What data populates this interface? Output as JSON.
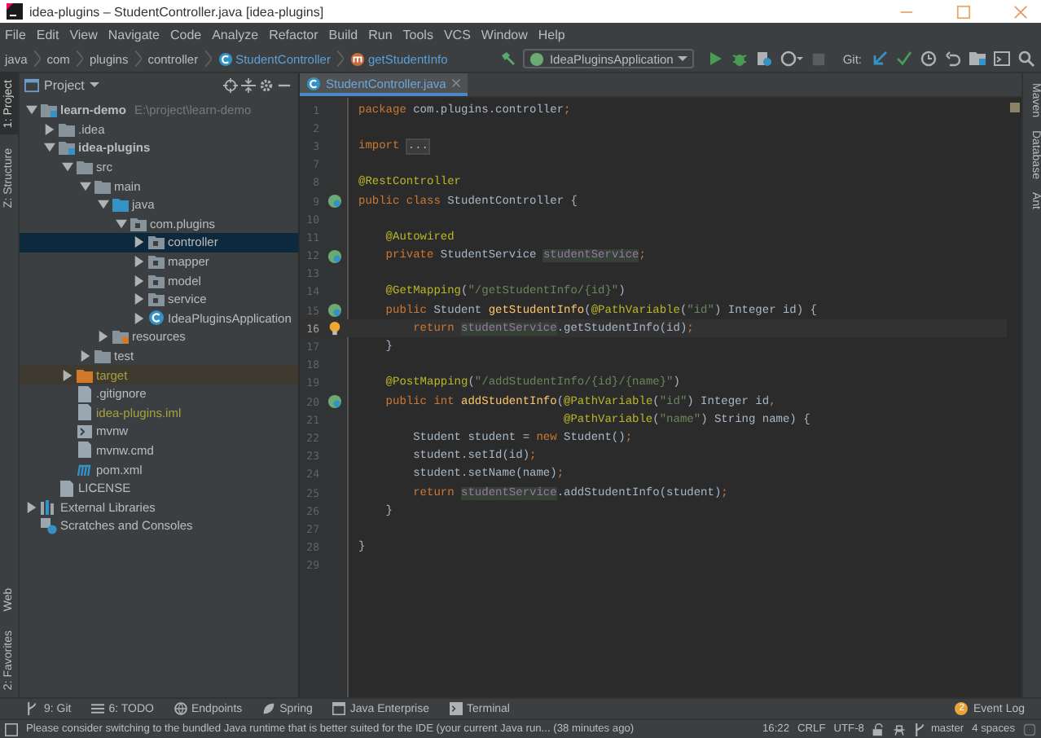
{
  "window": {
    "title": "idea-plugins – StudentController.java [idea-plugins]"
  },
  "menu": [
    "File",
    "Edit",
    "View",
    "Navigate",
    "Code",
    "Analyze",
    "Refactor",
    "Build",
    "Run",
    "Tools",
    "VCS",
    "Window",
    "Help"
  ],
  "breadcrumbs": [
    {
      "label": "java",
      "kind": "plain"
    },
    {
      "label": "com",
      "kind": "plain"
    },
    {
      "label": "plugins",
      "kind": "plain"
    },
    {
      "label": "controller",
      "kind": "plain"
    },
    {
      "label": "StudentController",
      "kind": "class"
    },
    {
      "label": "getStudentInfo",
      "kind": "method"
    }
  ],
  "run_config": "IdeaPluginsApplication",
  "git_label": "Git:",
  "left_stripe": [
    {
      "label": "1: Project",
      "selected": true
    },
    {
      "label": "Z: Structure",
      "selected": false
    }
  ],
  "left_stripe_bottom": [
    {
      "label": "Web",
      "selected": false
    },
    {
      "label": "2: Favorites",
      "selected": false
    }
  ],
  "right_stripe": [
    "Maven",
    "Database",
    "Ant"
  ],
  "project_panel": {
    "title": "Project",
    "tree": [
      {
        "label": "learn-demo",
        "kind": "module",
        "path": "E:\\project\\learn-demo",
        "expanded": true,
        "selected": false,
        "ignored": false,
        "children": [
          {
            "label": ".idea",
            "kind": "folder",
            "expanded": false,
            "selected": false,
            "ignored": false
          },
          {
            "label": "idea-plugins",
            "kind": "module",
            "expanded": true,
            "selected": false,
            "ignored": false,
            "children": [
              {
                "label": "src",
                "kind": "folder",
                "expanded": true,
                "selected": false,
                "ignored": false,
                "children": [
                  {
                    "label": "main",
                    "kind": "folder",
                    "expanded": true,
                    "selected": false,
                    "ignored": false,
                    "children": [
                      {
                        "label": "java",
                        "kind": "source",
                        "expanded": true,
                        "selected": false,
                        "ignored": false,
                        "children": [
                          {
                            "label": "com.plugins",
                            "kind": "package",
                            "expanded": true,
                            "selected": false,
                            "ignored": false,
                            "children": [
                              {
                                "label": "controller",
                                "kind": "package",
                                "expanded": false,
                                "selected": true,
                                "ignored": false
                              },
                              {
                                "label": "mapper",
                                "kind": "package",
                                "expanded": false,
                                "selected": false,
                                "ignored": false
                              },
                              {
                                "label": "model",
                                "kind": "package",
                                "expanded": false,
                                "selected": false,
                                "ignored": false
                              },
                              {
                                "label": "service",
                                "kind": "package",
                                "expanded": false,
                                "selected": false,
                                "ignored": false
                              },
                              {
                                "label": "IdeaPluginsApplication",
                                "kind": "spring-class",
                                "expanded": false,
                                "selected": false,
                                "ignored": false
                              }
                            ]
                          }
                        ]
                      },
                      {
                        "label": "resources",
                        "kind": "resources",
                        "expanded": false,
                        "selected": false,
                        "ignored": false
                      }
                    ]
                  },
                  {
                    "label": "test",
                    "kind": "folder",
                    "expanded": false,
                    "selected": false,
                    "ignored": false
                  }
                ]
              },
              {
                "label": "target",
                "kind": "excluded",
                "expanded": false,
                "selected": false,
                "ignored": true
              },
              {
                "label": ".gitignore",
                "kind": "file",
                "selected": false,
                "ignored": false
              },
              {
                "label": "idea-plugins.iml",
                "kind": "file",
                "selected": false,
                "ignored": true
              },
              {
                "label": "mvnw",
                "kind": "script",
                "selected": false,
                "ignored": false
              },
              {
                "label": "mvnw.cmd",
                "kind": "file",
                "selected": false,
                "ignored": false
              },
              {
                "label": "pom.xml",
                "kind": "maven",
                "selected": false,
                "ignored": false
              }
            ]
          },
          {
            "label": "LICENSE",
            "kind": "file",
            "selected": false,
            "ignored": false
          }
        ]
      },
      {
        "label": "External Libraries",
        "kind": "library",
        "expanded": false,
        "selected": false,
        "ignored": false
      },
      {
        "label": "Scratches and Consoles",
        "kind": "scratches",
        "selected": false,
        "ignored": false
      }
    ]
  },
  "editor": {
    "tabs": [
      {
        "label": "StudentController.java",
        "selected": true
      }
    ],
    "lines": [
      {
        "number": "1",
        "kind": "plain",
        "current": false,
        "tokens": [
          {
            "text": "package ",
            "kind": "kw"
          },
          {
            "text": "com.plugins.controller",
            "kind": "plain"
          },
          {
            "text": ";",
            "kind": "kw"
          }
        ]
      },
      {
        "number": "2",
        "kind": "plain",
        "current": false
      },
      {
        "number": "3",
        "kind": "plain",
        "current": false,
        "tokens": [
          {
            "text": "import ",
            "kind": "kw"
          },
          {
            "text": "...",
            "kind": "fold"
          }
        ]
      },
      {
        "number": "7",
        "kind": "plain",
        "current": false
      },
      {
        "number": "8",
        "kind": "plain",
        "current": false,
        "tokens": [
          {
            "text": "@RestController",
            "kind": "ann"
          }
        ]
      },
      {
        "number": "9",
        "kind": "bean",
        "current": false,
        "tokens": [
          {
            "text": "public class ",
            "kind": "kw"
          },
          {
            "text": "StudentController {",
            "kind": "plain"
          }
        ]
      },
      {
        "number": "10",
        "kind": "plain",
        "current": false
      },
      {
        "number": "11",
        "kind": "plain",
        "current": false,
        "tokens": [
          {
            "text": "    @Autowired",
            "kind": "ann"
          }
        ]
      },
      {
        "number": "12",
        "kind": "bean",
        "current": false,
        "tokens": [
          {
            "text": "    private ",
            "kind": "kw"
          },
          {
            "text": "StudentService ",
            "kind": "plain"
          },
          {
            "text": "studentService",
            "kind": "usage"
          },
          {
            "text": ";",
            "kind": "kw"
          }
        ]
      },
      {
        "number": "13",
        "kind": "plain",
        "current": false
      },
      {
        "number": "14",
        "kind": "plain",
        "current": false,
        "tokens": [
          {
            "text": "    @GetMapping",
            "kind": "ann"
          },
          {
            "text": "(",
            "kind": "plain"
          },
          {
            "text": "\"/getStudentInfo/{id}\"",
            "kind": "str"
          },
          {
            "text": ")",
            "kind": "plain"
          }
        ]
      },
      {
        "number": "15",
        "kind": "bean",
        "current": false,
        "tokens": [
          {
            "text": "    public ",
            "kind": "kw"
          },
          {
            "text": "Student ",
            "kind": "plain"
          },
          {
            "text": "getStudentInfo",
            "kind": "method"
          },
          {
            "text": "(",
            "kind": "plain"
          },
          {
            "text": "@PathVariable",
            "kind": "ann"
          },
          {
            "text": "(",
            "kind": "plain"
          },
          {
            "text": "\"id\"",
            "kind": "str"
          },
          {
            "text": ") Integer id) {",
            "kind": "plain"
          }
        ]
      },
      {
        "number": "16",
        "kind": "bulb",
        "current": true,
        "tokens": [
          {
            "text": "        return ",
            "kind": "kw"
          },
          {
            "text": "studentService",
            "kind": "usage"
          },
          {
            "text": ".getStudentInfo(id)",
            "kind": "plain"
          },
          {
            "text": ";",
            "kind": "kw"
          }
        ]
      },
      {
        "number": "17",
        "kind": "plain",
        "current": false,
        "tokens": [
          {
            "text": "    }",
            "kind": "plain"
          }
        ]
      },
      {
        "number": "18",
        "kind": "plain",
        "current": false
      },
      {
        "number": "19",
        "kind": "plain",
        "current": false,
        "tokens": [
          {
            "text": "    @PostMapping",
            "kind": "ann"
          },
          {
            "text": "(",
            "kind": "plain"
          },
          {
            "text": "\"/addStudentInfo/{id}/{name}\"",
            "kind": "str"
          },
          {
            "text": ")",
            "kind": "plain"
          }
        ]
      },
      {
        "number": "20",
        "kind": "bean",
        "current": false,
        "tokens": [
          {
            "text": "    public int ",
            "kind": "kw"
          },
          {
            "text": "addStudentInfo",
            "kind": "method"
          },
          {
            "text": "(",
            "kind": "plain"
          },
          {
            "text": "@PathVariable",
            "kind": "ann"
          },
          {
            "text": "(",
            "kind": "plain"
          },
          {
            "text": "\"id\"",
            "kind": "str"
          },
          {
            "text": ") Integer id",
            "kind": "plain"
          },
          {
            "text": ",",
            "kind": "kw"
          }
        ]
      },
      {
        "number": "21",
        "kind": "plain",
        "current": false,
        "tokens": [
          {
            "text": "                              @PathVariable",
            "kind": "ann"
          },
          {
            "text": "(",
            "kind": "plain"
          },
          {
            "text": "\"name\"",
            "kind": "str"
          },
          {
            "text": ") String name) {",
            "kind": "plain"
          }
        ]
      },
      {
        "number": "22",
        "kind": "plain",
        "current": false,
        "tokens": [
          {
            "text": "        Student student = ",
            "kind": "plain"
          },
          {
            "text": "new ",
            "kind": "kw"
          },
          {
            "text": "Student()",
            "kind": "plain"
          },
          {
            "text": ";",
            "kind": "kw"
          }
        ]
      },
      {
        "number": "23",
        "kind": "plain",
        "current": false,
        "tokens": [
          {
            "text": "        student.setId(id)",
            "kind": "plain"
          },
          {
            "text": ";",
            "kind": "kw"
          }
        ]
      },
      {
        "number": "24",
        "kind": "plain",
        "current": false,
        "tokens": [
          {
            "text": "        student.setName(name)",
            "kind": "plain"
          },
          {
            "text": ";",
            "kind": "kw"
          }
        ]
      },
      {
        "number": "25",
        "kind": "plain",
        "current": false,
        "tokens": [
          {
            "text": "        return ",
            "kind": "kw"
          },
          {
            "text": "studentService",
            "kind": "usage"
          },
          {
            "text": ".addStudentInfo(student)",
            "kind": "plain"
          },
          {
            "text": ";",
            "kind": "kw"
          }
        ]
      },
      {
        "number": "26",
        "kind": "plain",
        "current": false,
        "tokens": [
          {
            "text": "    }",
            "kind": "plain"
          }
        ]
      },
      {
        "number": "27",
        "kind": "plain",
        "current": false
      },
      {
        "number": "28",
        "kind": "plain",
        "current": false,
        "tokens": [
          {
            "text": "}",
            "kind": "plain"
          }
        ]
      },
      {
        "number": "29",
        "kind": "plain",
        "current": false
      }
    ]
  },
  "tool_windows": [
    {
      "label": "9: Git",
      "kind": "git"
    },
    {
      "label": "6: TODO",
      "kind": "list"
    },
    {
      "label": "Endpoints",
      "kind": "globe"
    },
    {
      "label": "Spring",
      "kind": "leaf"
    },
    {
      "label": "Java Enterprise",
      "kind": "window"
    },
    {
      "label": "Terminal",
      "kind": "terminal"
    }
  ],
  "event_log": {
    "label": "Event Log",
    "badge": "2"
  },
  "status_bar": {
    "message": "Please consider switching to the bundled Java runtime that is better suited for the IDE (your current Java run... (38 minutes ago)",
    "position": "16:22",
    "line_separator": "CRLF",
    "encoding": "UTF-8",
    "branch": "master",
    "indent": "4 spaces"
  }
}
